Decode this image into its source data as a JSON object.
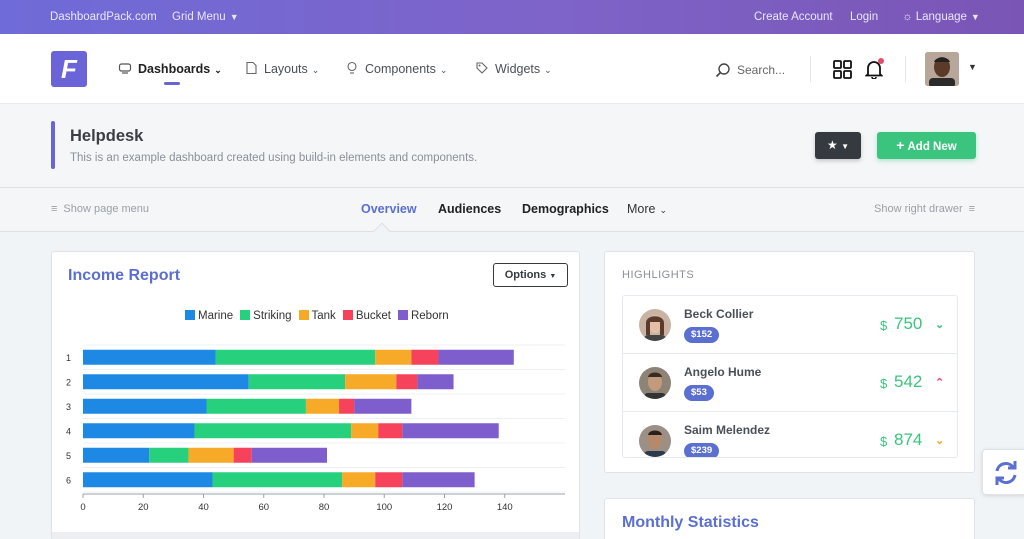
{
  "topbar": {
    "brand": "DashboardPack.com",
    "grid_menu": "Grid Menu",
    "create_account": "Create Account",
    "login": "Login",
    "language": "Language"
  },
  "header": {
    "logo_letter": "F",
    "nav": [
      {
        "label": "Dashboards",
        "icon": "dashboards-icon",
        "active": true
      },
      {
        "label": "Layouts",
        "icon": "layouts-icon"
      },
      {
        "label": "Components",
        "icon": "components-icon"
      },
      {
        "label": "Widgets",
        "icon": "widgets-icon"
      }
    ],
    "search_placeholder": "Search...",
    "notification_dot_color": "#e74c6b"
  },
  "page": {
    "title": "Helpdesk",
    "subtitle": "This is an example dashboard created using build-in elements and components.",
    "add_new": "Add New"
  },
  "tabs": {
    "show_page_menu": "Show page menu",
    "items": [
      "Overview",
      "Audiences",
      "Demographics",
      "More"
    ],
    "active": "Overview",
    "show_right_drawer": "Show right drawer"
  },
  "income_report": {
    "title": "Income Report",
    "options_label": "Options"
  },
  "chart_data": {
    "type": "bar",
    "orientation": "horizontal",
    "stacked": true,
    "categories": [
      "1",
      "2",
      "3",
      "4",
      "5",
      "6"
    ],
    "series": [
      {
        "name": "Marine",
        "color": "#1e88e5",
        "values": [
          44,
          55,
          41,
          37,
          22,
          43
        ]
      },
      {
        "name": "Striking",
        "color": "#26d07c",
        "values": [
          53,
          32,
          33,
          52,
          13,
          43
        ]
      },
      {
        "name": "Tank",
        "color": "#f7a928",
        "values": [
          12,
          17,
          11,
          9,
          15,
          11
        ]
      },
      {
        "name": "Bucket",
        "color": "#f6425b",
        "values": [
          9,
          7,
          5,
          8,
          6,
          9
        ]
      },
      {
        "name": "Reborn",
        "color": "#7e5dcc",
        "values": [
          25,
          12,
          19,
          32,
          25,
          24
        ]
      }
    ],
    "xticks": [
      "0",
      "20",
      "40",
      "60",
      "80",
      "100",
      "120",
      "140"
    ],
    "xlim": [
      0,
      160
    ],
    "legend": "top"
  },
  "highlights": {
    "title": "HIGHLIGHTS",
    "rows": [
      {
        "name": "Beck Collier",
        "badge": "$152",
        "currency": "$",
        "value": "750",
        "trend": "down",
        "trend_color": "#3ac47d"
      },
      {
        "name": "Angelo Hume",
        "badge": "$53",
        "currency": "$",
        "value": "542",
        "trend": "up",
        "trend_color": "#e74c6b"
      },
      {
        "name": "Saim Melendez",
        "badge": "$239",
        "currency": "$",
        "value": "874",
        "trend": "down",
        "trend_color": "#f7a928"
      }
    ]
  },
  "monthly": {
    "title": "Monthly Statistics"
  },
  "colors": {
    "primary": "#6a64d8",
    "success": "#3ac47d",
    "dark": "#343a40"
  }
}
